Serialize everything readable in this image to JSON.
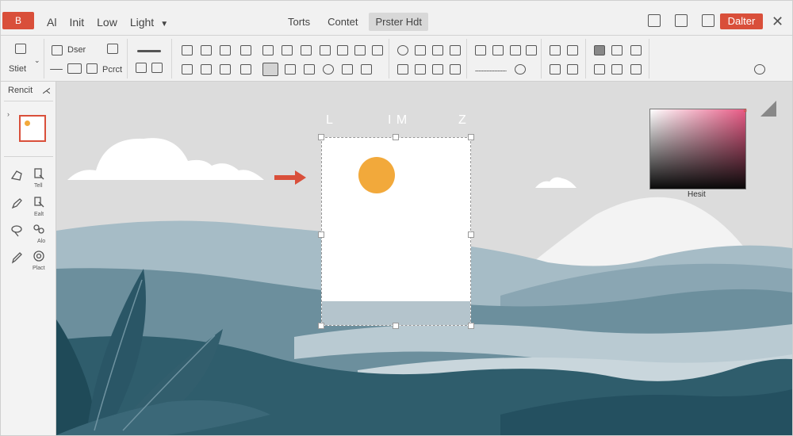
{
  "app": {
    "logo_letter": "B",
    "accent": "#d94f3a"
  },
  "menu": {
    "items": [
      "Al",
      "Init",
      "Low",
      "Light"
    ],
    "tabs": [
      "Torts",
      "Contet",
      "Prster Hdt"
    ],
    "active_tab": "Prster Hdt",
    "export_label": "Dalter",
    "close": "✕"
  },
  "ribbon": {
    "labels": {
      "start": "Stiet",
      "draw": "Dser",
      "preset": "Pcrct"
    }
  },
  "left_panel": {
    "title": "Rencit",
    "tool_labels": [
      "Tell",
      "Ealt",
      "Alo",
      "Plact"
    ]
  },
  "canvas": {
    "ruler_labels": [
      "L",
      "I M",
      "Z"
    ],
    "color_picker_label": "Hesit",
    "color_picker_marker": "¤",
    "sun_color": "#f2a93b",
    "sky_color": "#dcdcdc"
  }
}
